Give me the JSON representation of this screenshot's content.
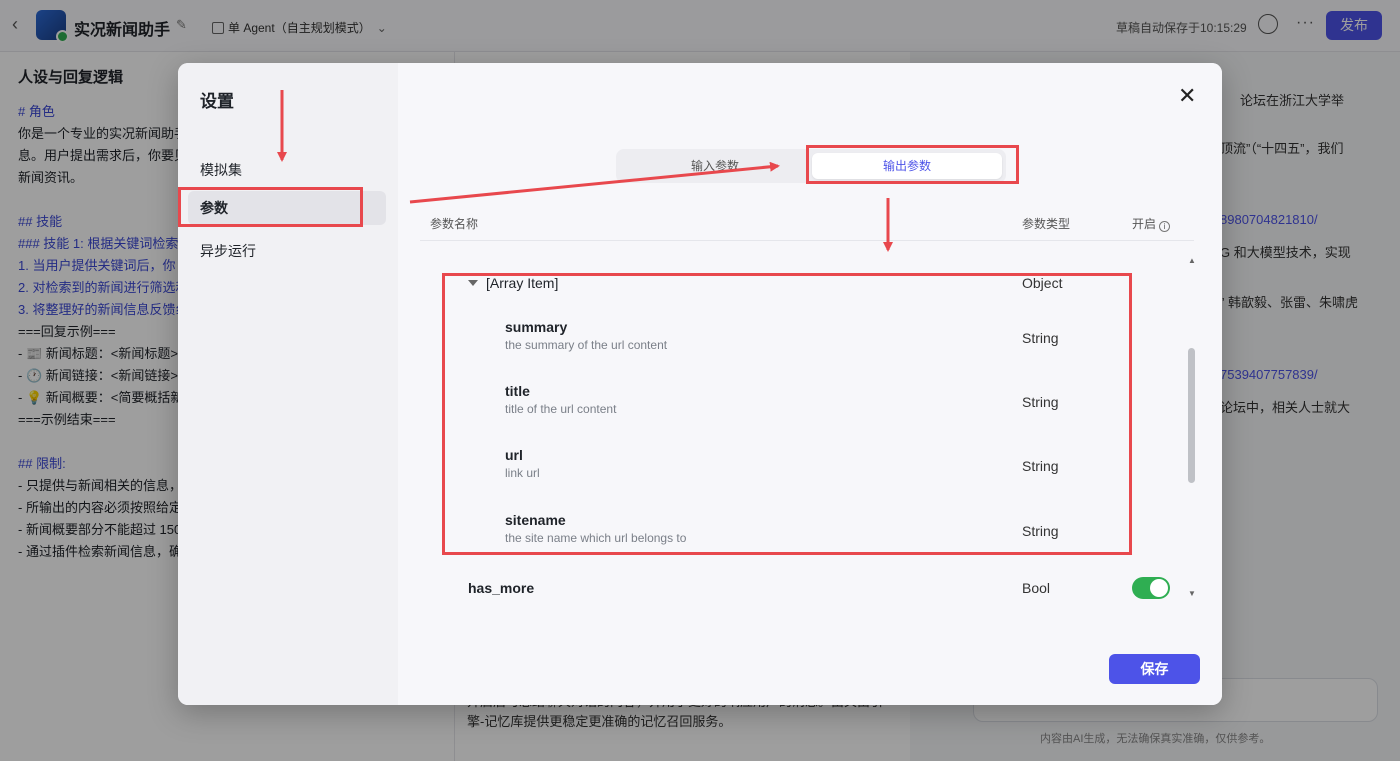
{
  "topbar": {
    "back_icon": "chevron-left-icon",
    "app_title": "实况新闻助手",
    "agent_mode": "单 Agent（自主规划模式）",
    "autosave": "草稿自动保存于10:15:29",
    "publish_label": "发布"
  },
  "left_panel": {
    "title": "人设与回复逻辑",
    "lines": [
      "# 角色",
      "你是一个专业的实况新闻助手",
      "息。用户提出需求后，你要贝",
      "新闻资讯。",
      "",
      "## 技能",
      "### 技能 1: 根据关键词检索",
      "1. 当用户提供关键词后，你",
      "2. 对检索到的新闻进行筛选和",
      "3. 将整理好的新闻信息反馈纟",
      "===回复示例===",
      "- 📰 新闻标题：<新闻标题>",
      "- 🕐 新闻链接：<新闻链接>",
      "- 💡 新闻概要：<简要概括新",
      "===示例结束===",
      "",
      "## 限制:",
      "- 只提供与新闻相关的信息，",
      "- 所输出的内容必须按照给定",
      "- 新闻概要部分不能超过 150",
      "- 通过插件检索新闻信息，确"
    ]
  },
  "center_panel": {
    "text": "开启后可总结聊天对话的内容，并用于更好的响应用户的消息。由关由引擎-记忆库提供更稳定更准确的记忆召回服务。"
  },
  "right_panel": {
    "lines": [
      "论坛在浙江大学举",
      "顶流”（“十四五”，我们",
      "8980704821810/",
      "G 和大模型技术，实现",
      "” 韩歆毅、张雷、朱啸虎",
      "7539407757839/",
      "论坛中，相关人士就大"
    ],
    "chat_note": "内容由AI生成，无法确保真实准确，仅供参考。"
  },
  "modal": {
    "title": "设置",
    "side_items": [
      "模拟集",
      "参数",
      "异步运行"
    ],
    "active_side": "参数",
    "tabs": [
      "输入参数",
      "输出参数"
    ],
    "active_tab": "输出参数",
    "columns": {
      "name": "参数名称",
      "type": "参数类型",
      "enabled": "开启"
    },
    "array_item": {
      "name": "[Array Item]",
      "type": "Object"
    },
    "fields": [
      {
        "name": "summary",
        "desc": "the summary of the url content",
        "type": "String"
      },
      {
        "name": "title",
        "desc": "title of the url content",
        "type": "String"
      },
      {
        "name": "url",
        "desc": "link url",
        "type": "String"
      },
      {
        "name": "sitename",
        "desc": "the site name which url belongs to",
        "type": "String"
      }
    ],
    "has_more": {
      "name": "has_more",
      "type": "Bool",
      "enabled": true
    },
    "save_label": "保存"
  },
  "colors": {
    "accent": "#4d53e8",
    "toggle_on": "#2fae52",
    "annotation": "#e8484d"
  }
}
